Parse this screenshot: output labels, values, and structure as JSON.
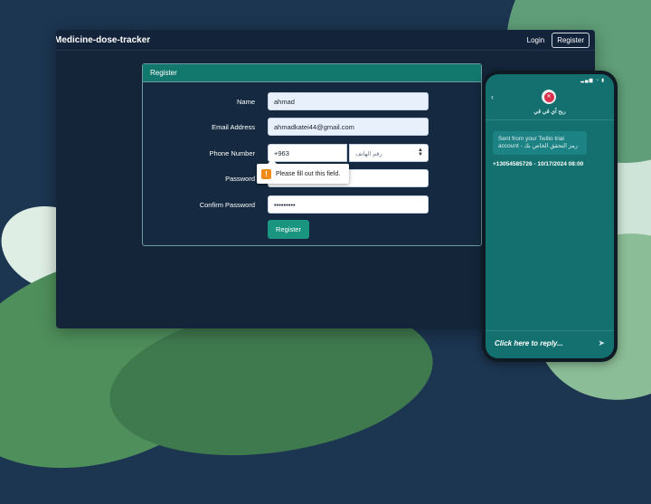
{
  "app": {
    "brand": "Medicine-dose-tracker",
    "nav": {
      "login": "Login",
      "register": "Register"
    }
  },
  "form": {
    "header": "Register",
    "fields": {
      "name": {
        "label": "Name",
        "value": "ahmad"
      },
      "email": {
        "label": "Email Address",
        "value": "ahmadkatei44@gmail.com"
      },
      "phone": {
        "label": "Phone Number",
        "code": "+963",
        "placeholder": "رقم الهاتف"
      },
      "password": {
        "label": "Password",
        "value": "•••••••••"
      },
      "confirm": {
        "label": "Confirm Password",
        "value": "•••••••••"
      }
    },
    "validation_message": "Please fill out this field.",
    "submit_label": "Register"
  },
  "phone_ui": {
    "status_icons": "▂▄▆ ◔ ▮",
    "back_icon": "‹",
    "contact_name": "ربح آي ڤي ڤي",
    "message_text": "Sent from your Twilio trial account - رمز التحقق الخاص بك",
    "message_meta": "+13054585726 - 10/17/2024 08:00",
    "reply_placeholder": "Click here to reply...",
    "send_icon": "➤"
  },
  "colors": {
    "accent": "#12786e",
    "button": "#1a9680",
    "warning": "#f08a18"
  }
}
